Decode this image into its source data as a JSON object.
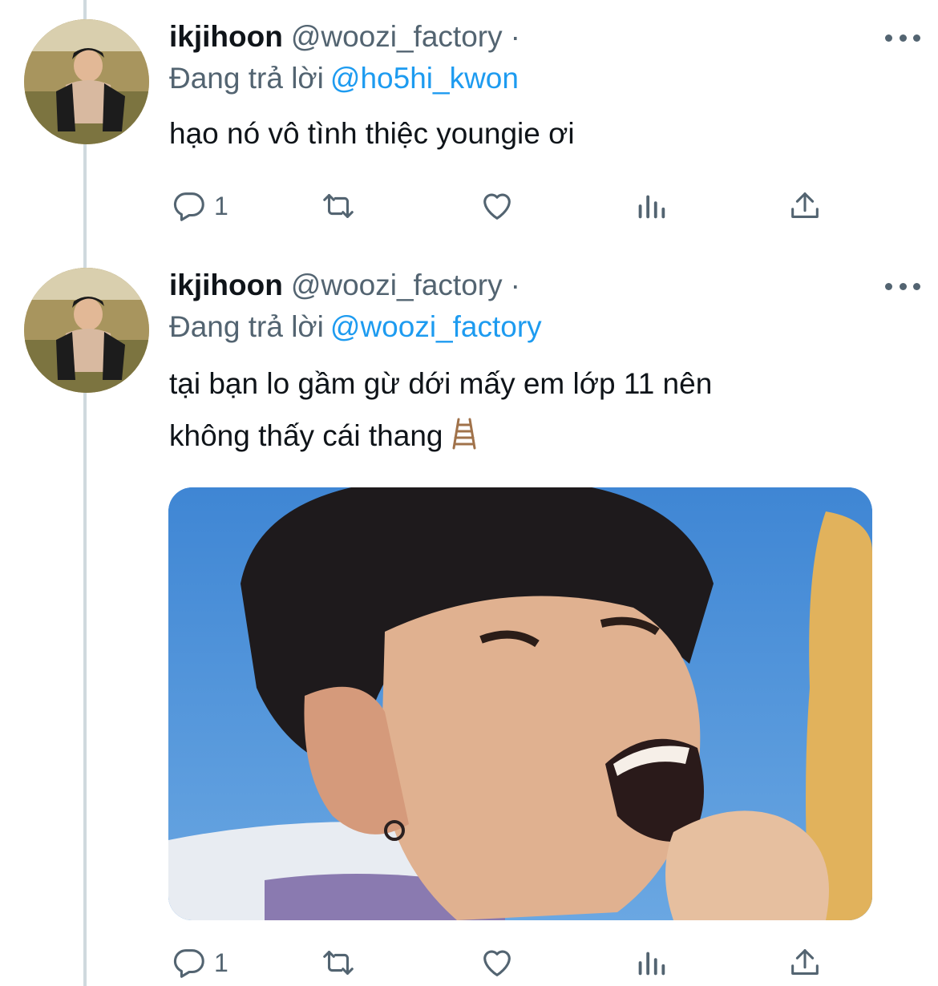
{
  "tweets": [
    {
      "display_name": "ikjihoon",
      "handle": "@woozi_factory",
      "separator": "·",
      "reply_prefix": "Đang trả lời",
      "reply_to": "@ho5hi_kwon",
      "text_lines": [
        "hạo nó vô tình thiệc youngie ơi"
      ],
      "reply_count": "1",
      "has_media": false
    },
    {
      "display_name": "ikjihoon",
      "handle": "@woozi_factory",
      "separator": "·",
      "reply_prefix": "Đang trả lời",
      "reply_to": "@woozi_factory",
      "text_lines": [
        "tại bạn lo gầm gừ dới mấy em lớp 11 nên",
        "không thấy cái thang"
      ],
      "emoji": "ladder-emoji",
      "reply_count": "1",
      "has_media": true
    }
  ],
  "icons": {
    "reply": "reply-icon",
    "retweet": "retweet-icon",
    "like": "heart-icon",
    "stats": "analytics-icon",
    "share": "share-icon",
    "more": "more-icon"
  },
  "colors": {
    "link": "#1d9bf0",
    "secondary_text": "#536471",
    "primary_text": "#0f1419",
    "thread_line": "#cfd9de"
  }
}
